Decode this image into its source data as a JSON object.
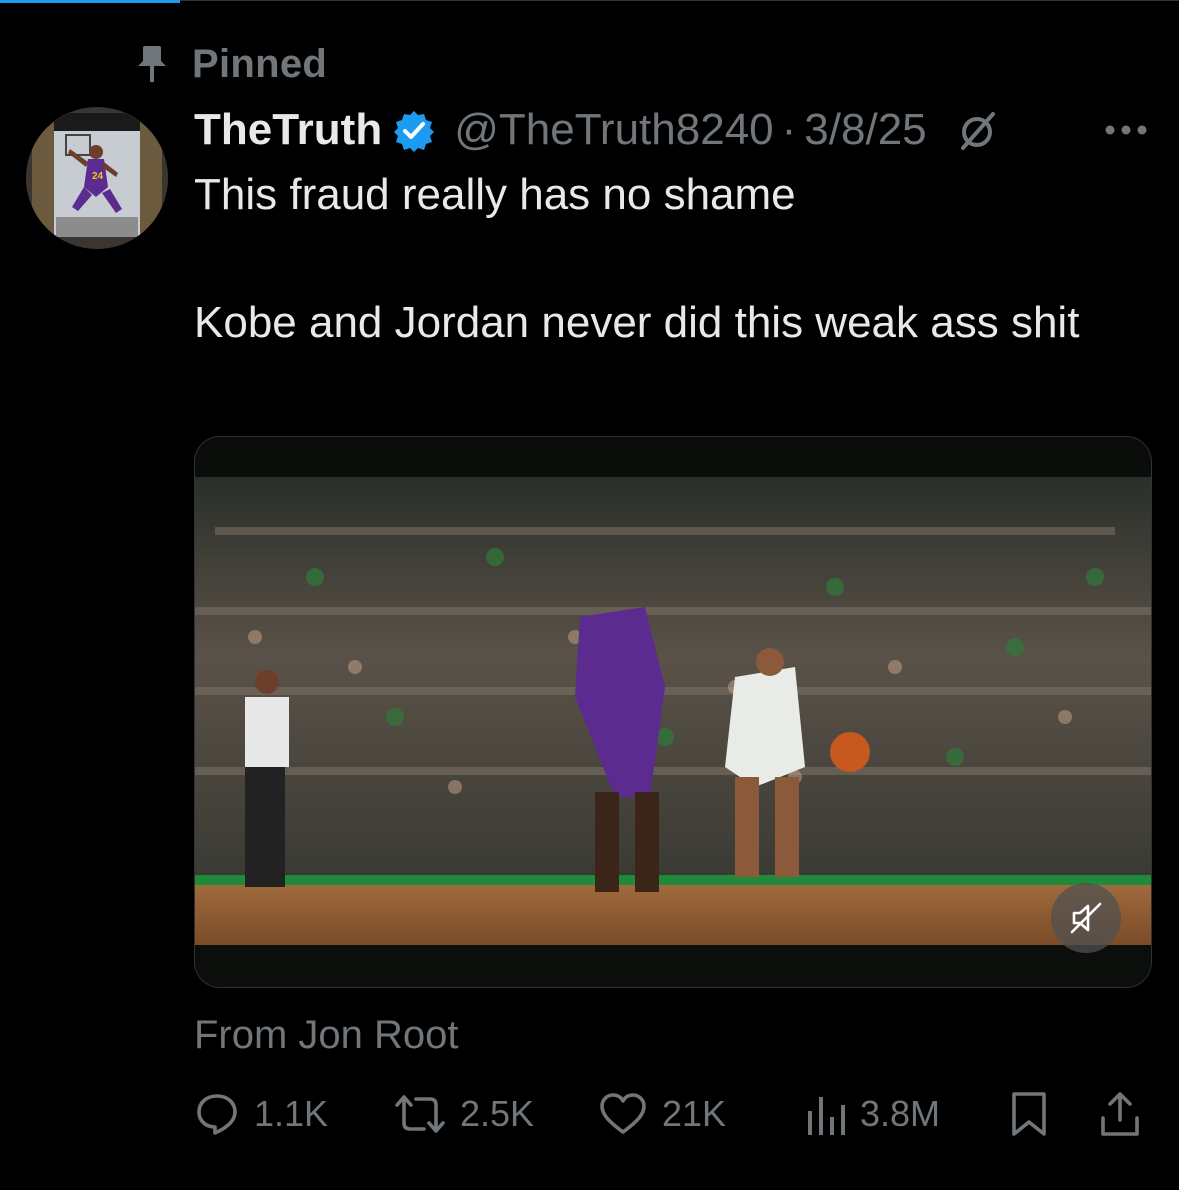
{
  "pinned": {
    "label": "Pinned",
    "icon": "pin-icon"
  },
  "tweet": {
    "author": {
      "display_name": "TheTruth",
      "handle": "@TheTruth8240",
      "verified": true
    },
    "separator": "·",
    "date": "3/8/25",
    "text_line_1": "This fraud really has no shame",
    "text_line_2": "Kobe and Jordan never did this weak ass shit",
    "media": {
      "type": "video",
      "muted": true
    },
    "source": "From Jon Root",
    "actions": {
      "replies": "1.1K",
      "reposts": "2.5K",
      "likes": "21K",
      "views": "3.8M"
    }
  },
  "colors": {
    "background": "#000000",
    "text_primary": "#e7e9ea",
    "text_secondary": "#71767b",
    "verified_blue": "#1d9bf0",
    "accent_blue": "#1d9bf0"
  }
}
